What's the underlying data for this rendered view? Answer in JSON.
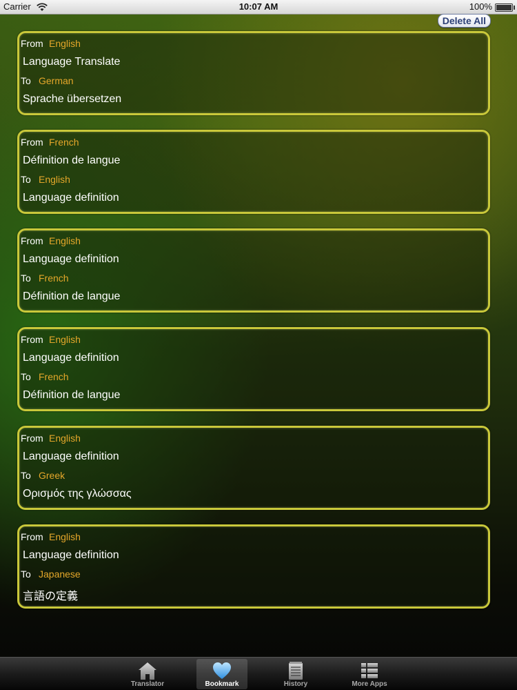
{
  "status_bar": {
    "carrier": "Carrier",
    "time": "10:07 AM",
    "battery": "100%"
  },
  "toolbar": {
    "delete_all_label": "Delete All"
  },
  "bookmarks": [
    {
      "from_label": "From",
      "from_lang": "English",
      "source": "Language Translate",
      "to_label": "To",
      "to_lang": "German",
      "target": "Sprache übersetzen"
    },
    {
      "from_label": "From",
      "from_lang": "French",
      "source": "Définition de langue",
      "to_label": "To",
      "to_lang": "English",
      "target": "Language definition"
    },
    {
      "from_label": "From",
      "from_lang": "English",
      "source": "Language definition",
      "to_label": "To",
      "to_lang": "French",
      "target": "Définition de langue"
    },
    {
      "from_label": "From",
      "from_lang": "English",
      "source": "Language definition",
      "to_label": "To",
      "to_lang": "French",
      "target": "Définition de langue"
    },
    {
      "from_label": "From",
      "from_lang": "English",
      "source": "Language definition",
      "to_label": "To",
      "to_lang": "Greek",
      "target": "Ορισμός της γλώσσας"
    },
    {
      "from_label": "From",
      "from_lang": "English",
      "source": "Language definition",
      "to_label": "To",
      "to_lang": "Japanese",
      "target": "言語の定義"
    }
  ],
  "tabs": [
    {
      "label": "Translator",
      "icon": "house-icon",
      "selected": false
    },
    {
      "label": "Bookmark",
      "icon": "heart-icon",
      "selected": true
    },
    {
      "label": "History",
      "icon": "notepad-icon",
      "selected": false
    },
    {
      "label": "More Apps",
      "icon": "list-icon",
      "selected": false
    }
  ],
  "colors": {
    "card_border": "#c9c83a",
    "language_name": "#e5a72a",
    "delete_button_text": "#2c3f75"
  }
}
